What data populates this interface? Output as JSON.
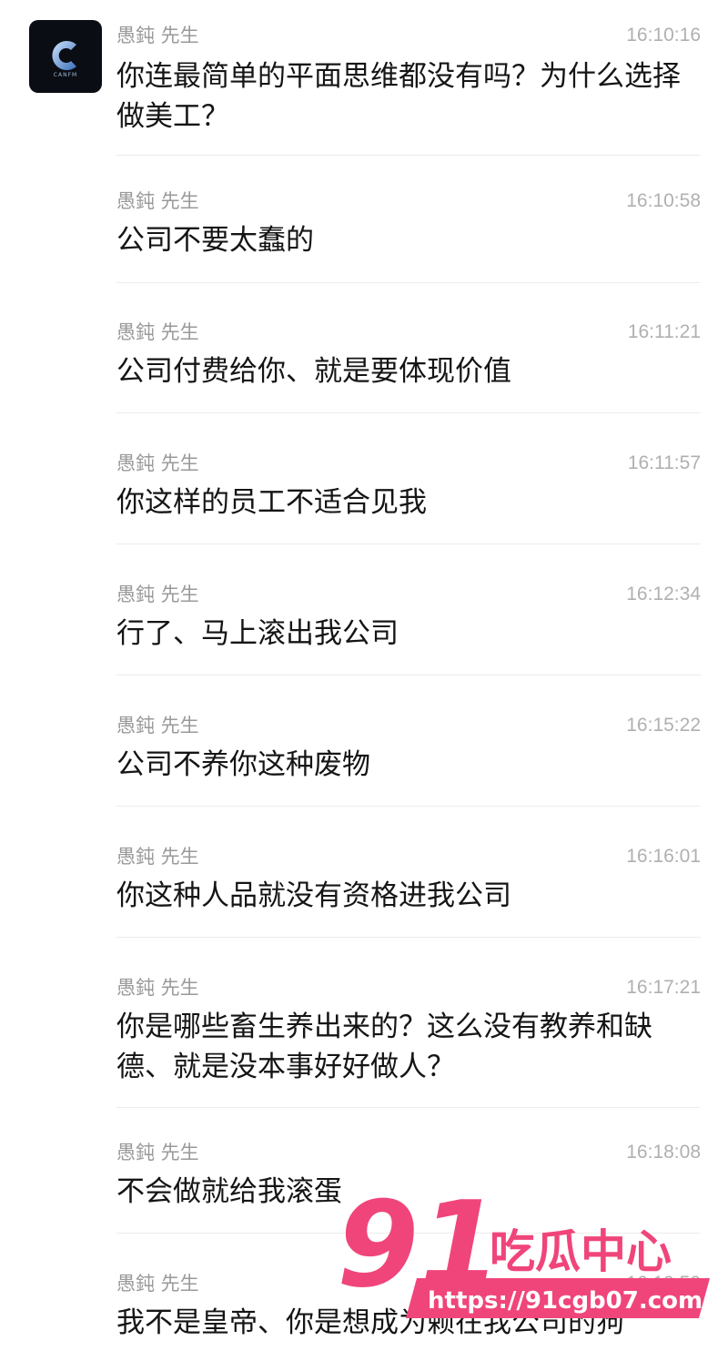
{
  "avatar": {
    "logo_letter": "C",
    "logo_text": "CANFM"
  },
  "messages": [
    {
      "sender": "愚鈍 先生",
      "time": "16:10:16",
      "text": "你连最简单的平面思维都没有吗？为什么选择做美工？"
    },
    {
      "sender": "愚鈍 先生",
      "time": "16:10:58",
      "text": "公司不要太蠢的"
    },
    {
      "sender": "愚鈍 先生",
      "time": "16:11:21",
      "text": "公司付费给你、就是要体现价值"
    },
    {
      "sender": "愚鈍 先生",
      "time": "16:11:57",
      "text": "你这样的员工不适合见我"
    },
    {
      "sender": "愚鈍 先生",
      "time": "16:12:34",
      "text": "行了、马上滚出我公司"
    },
    {
      "sender": "愚鈍 先生",
      "time": "16:15:22",
      "text": "公司不养你这种废物"
    },
    {
      "sender": "愚鈍 先生",
      "time": "16:16:01",
      "text": "你这种人品就没有资格进我公司"
    },
    {
      "sender": "愚鈍 先生",
      "time": "16:17:21",
      "text": "你是哪些畜生养出来的？这么没有教养和缺德、就是没本事好好做人？"
    },
    {
      "sender": "愚鈍 先生",
      "time": "16:18:08",
      "text": "不会做就给我滚蛋"
    },
    {
      "sender": "愚鈍 先生",
      "time": "16:19:50",
      "text": "我不是皇帝、你是想成为赖在我公司的狗"
    }
  ],
  "watermark": {
    "number": "91",
    "brand": "吃瓜中心",
    "url": "https://91cgb07.com",
    "color": "#f0457a"
  }
}
